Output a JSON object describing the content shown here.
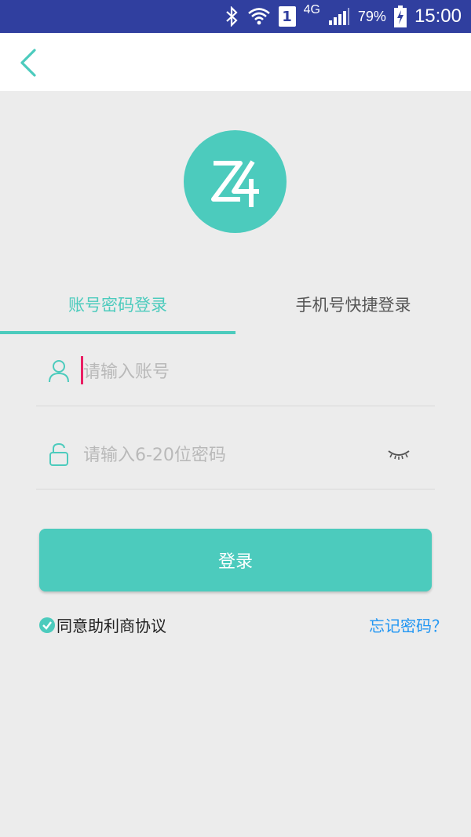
{
  "status_bar": {
    "network": "4G",
    "sim": "1",
    "battery_percent": "79%",
    "time": "15:00",
    "color": "#303f9f"
  },
  "icons": {
    "back": "chevron-left-icon",
    "logo": "z4-logo",
    "user": "user-icon",
    "lock": "lock-icon",
    "eye": "eye-closed-icon",
    "check": "check-icon"
  },
  "tabs": [
    {
      "label": "账号密码登录",
      "active": true
    },
    {
      "label": "手机号快捷登录",
      "active": false
    }
  ],
  "form": {
    "account": {
      "placeholder": "请输入账号",
      "value": ""
    },
    "password": {
      "placeholder": "请输入6-20位密码",
      "value": ""
    }
  },
  "login_button": "登录",
  "agreement": {
    "checked": true,
    "label": "同意助利商协议"
  },
  "forgot_password": "忘记密码？",
  "colors": {
    "accent": "#4ccbbd",
    "link": "#2196f3",
    "background": "#ececec"
  }
}
